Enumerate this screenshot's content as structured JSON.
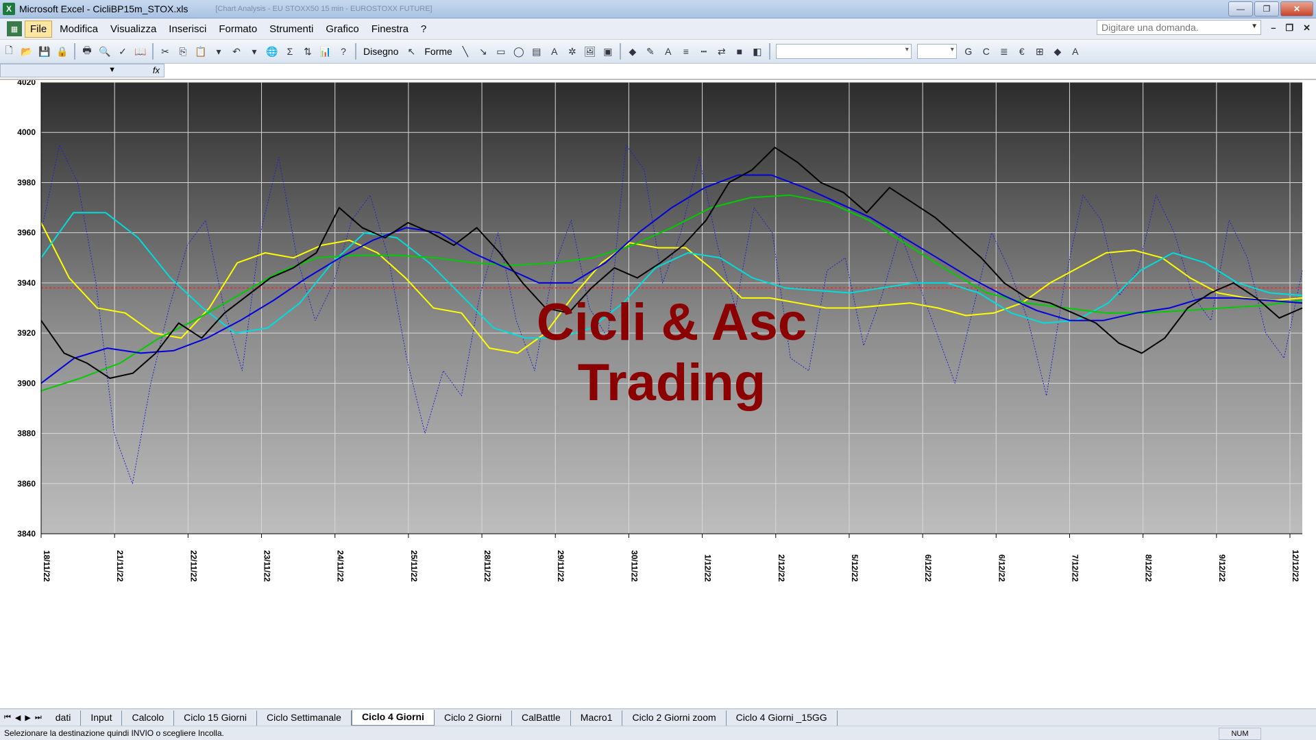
{
  "window": {
    "title": "Microsoft Excel - CicliBP15m_STOX.xls",
    "ghost_text": "[Chart Analysis - EU STOXX50 15 min - EUROSTOXX FUTURE]"
  },
  "menu": {
    "items": [
      "File",
      "Modifica",
      "Visualizza",
      "Inserisci",
      "Formato",
      "Strumenti",
      "Grafico",
      "Finestra",
      "?"
    ],
    "question_placeholder": "Digitare una domanda."
  },
  "toolbar": {
    "draw_label": "Disegno",
    "shapes_label": "Forme"
  },
  "sheets": {
    "tabs": [
      "dati",
      "Input",
      "Calcolo",
      "Ciclo 15 Giorni",
      "Ciclo Settimanale",
      "Ciclo 4 Giorni",
      "Ciclo 2 Giorni",
      "CalBattle",
      "Macro1",
      "Ciclo 2 Giorni zoom",
      "Ciclo 4 Giorni _15GG"
    ],
    "active": "Ciclo 4 Giorni"
  },
  "status": {
    "message": "Selezionare la destinazione quindi INVIO o scegliere Incolla.",
    "num": "NUM"
  },
  "watermark": {
    "line1": "Cicli & Asc",
    "line2": "Trading"
  },
  "chart_data": {
    "type": "line",
    "ylim": [
      3840,
      4020
    ],
    "yticks": [
      3840,
      3860,
      3880,
      3900,
      3920,
      3940,
      3960,
      3980,
      4000,
      4020
    ],
    "xticks": [
      "18/11/22",
      "21/11/22",
      "22/11/22",
      "23/11/22",
      "24/11/22",
      "25/11/22",
      "28/11/22",
      "29/11/22",
      "30/11/22",
      "1/12/22",
      "2/12/22",
      "5/12/22",
      "6/12/22",
      "6/12/22",
      "7/12/22",
      "8/12/22",
      "9/12/22",
      "12/12/22"
    ],
    "reference_line": 3938,
    "colors": {
      "price": "#000000",
      "blue": "#0000dd",
      "green": "#00cc00",
      "cyan": "#00dddd",
      "yellow": "#ffff00",
      "oscillator": "#2222cc",
      "reference": "#ff2020"
    },
    "series": [
      {
        "key": "price",
        "values": [
          3925,
          3912,
          3908,
          3902,
          3904,
          3912,
          3924,
          3918,
          3928,
          3935,
          3942,
          3946,
          3952,
          3970,
          3962,
          3958,
          3964,
          3960,
          3955,
          3962,
          3952,
          3940,
          3930,
          3928,
          3938,
          3946,
          3942,
          3948,
          3955,
          3965,
          3980,
          3985,
          3994,
          3988,
          3980,
          3976,
          3968,
          3978,
          3972,
          3966,
          3958,
          3950,
          3940,
          3934,
          3932,
          3928,
          3924,
          3916,
          3912,
          3918,
          3930,
          3936,
          3940,
          3934,
          3926,
          3930
        ]
      },
      {
        "key": "blue",
        "values": [
          3900,
          3910,
          3914,
          3912,
          3913,
          3918,
          3925,
          3933,
          3942,
          3950,
          3957,
          3962,
          3960,
          3952,
          3946,
          3940,
          3940,
          3948,
          3960,
          3970,
          3978,
          3983,
          3983,
          3978,
          3972,
          3966,
          3958,
          3950,
          3942,
          3935,
          3929,
          3925,
          3925,
          3928,
          3930,
          3934,
          3934,
          3933,
          3932
        ]
      },
      {
        "key": "green",
        "values": [
          3897,
          3902,
          3908,
          3918,
          3926,
          3935,
          3944,
          3950,
          3951,
          3951,
          3950,
          3948,
          3947,
          3948,
          3950,
          3955,
          3962,
          3970,
          3974,
          3975,
          3972,
          3965,
          3955,
          3945,
          3936,
          3932,
          3930,
          3928,
          3928,
          3929,
          3930,
          3931,
          3933
        ]
      },
      {
        "key": "cyan",
        "values": [
          3950,
          3968,
          3968,
          3958,
          3942,
          3930,
          3920,
          3922,
          3932,
          3948,
          3960,
          3958,
          3948,
          3935,
          3922,
          3918,
          3918,
          3922,
          3932,
          3946,
          3952,
          3950,
          3942,
          3938,
          3937,
          3936,
          3938,
          3940,
          3940,
          3936,
          3928,
          3924,
          3925,
          3932,
          3945,
          3952,
          3948,
          3940,
          3936,
          3935
        ]
      },
      {
        "key": "yellow",
        "values": [
          3964,
          3942,
          3930,
          3928,
          3920,
          3918,
          3930,
          3948,
          3952,
          3950,
          3955,
          3957,
          3952,
          3942,
          3930,
          3928,
          3914,
          3912,
          3920,
          3935,
          3948,
          3956,
          3954,
          3954,
          3945,
          3934,
          3934,
          3932,
          3930,
          3930,
          3931,
          3932,
          3930,
          3927,
          3928,
          3932,
          3940,
          3946,
          3952,
          3953,
          3950,
          3942,
          3936,
          3934,
          3933,
          3934
        ]
      },
      {
        "key": "oscillator",
        "values": [
          3960,
          3995,
          3980,
          3940,
          3880,
          3860,
          3900,
          3930,
          3955,
          3965,
          3930,
          3905,
          3960,
          3990,
          3950,
          3925,
          3940,
          3965,
          3975,
          3950,
          3910,
          3880,
          3905,
          3895,
          3935,
          3960,
          3925,
          3905,
          3945,
          3965,
          3930,
          3918,
          3995,
          3985,
          3940,
          3960,
          3990,
          3955,
          3930,
          3970,
          3960,
          3910,
          3905,
          3945,
          3950,
          3915,
          3935,
          3960,
          3940,
          3920,
          3900,
          3930,
          3960,
          3945,
          3925,
          3895,
          3940,
          3975,
          3965,
          3935,
          3945,
          3975,
          3960,
          3935,
          3925,
          3965,
          3950,
          3920,
          3910,
          3945
        ]
      }
    ]
  }
}
